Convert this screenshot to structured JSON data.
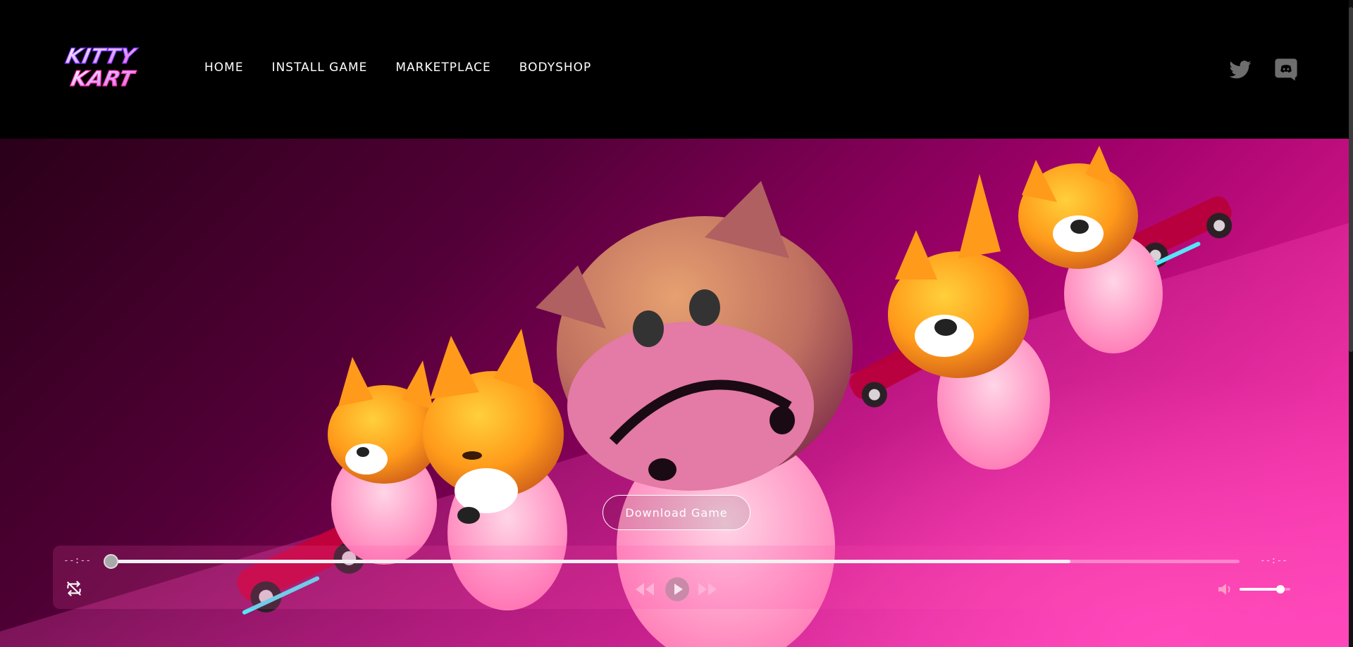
{
  "brand": {
    "logo_text_line1": "KITTY",
    "logo_text_line2": "KART"
  },
  "nav": {
    "items": [
      {
        "label": "HOME"
      },
      {
        "label": "INSTALL GAME"
      },
      {
        "label": "MARKETPLACE"
      },
      {
        "label": "BODYSHOP"
      }
    ]
  },
  "social": {
    "twitter_icon": "twitter-icon",
    "discord_icon": "discord-icon"
  },
  "hero": {
    "download_label": "Download Game"
  },
  "player": {
    "current_time": "--:--",
    "total_time": "--:--",
    "playback_progress": 0,
    "buffered_fraction": 0.85,
    "volume": 0.8,
    "icons": {
      "repeat": "repeat-icon",
      "rewind": "rewind-icon",
      "play": "play-icon",
      "forward": "fast-forward-icon",
      "volume": "volume-icon"
    }
  },
  "colors": {
    "accent_pink": "#ff2aa6",
    "header_bg": "#000000"
  }
}
